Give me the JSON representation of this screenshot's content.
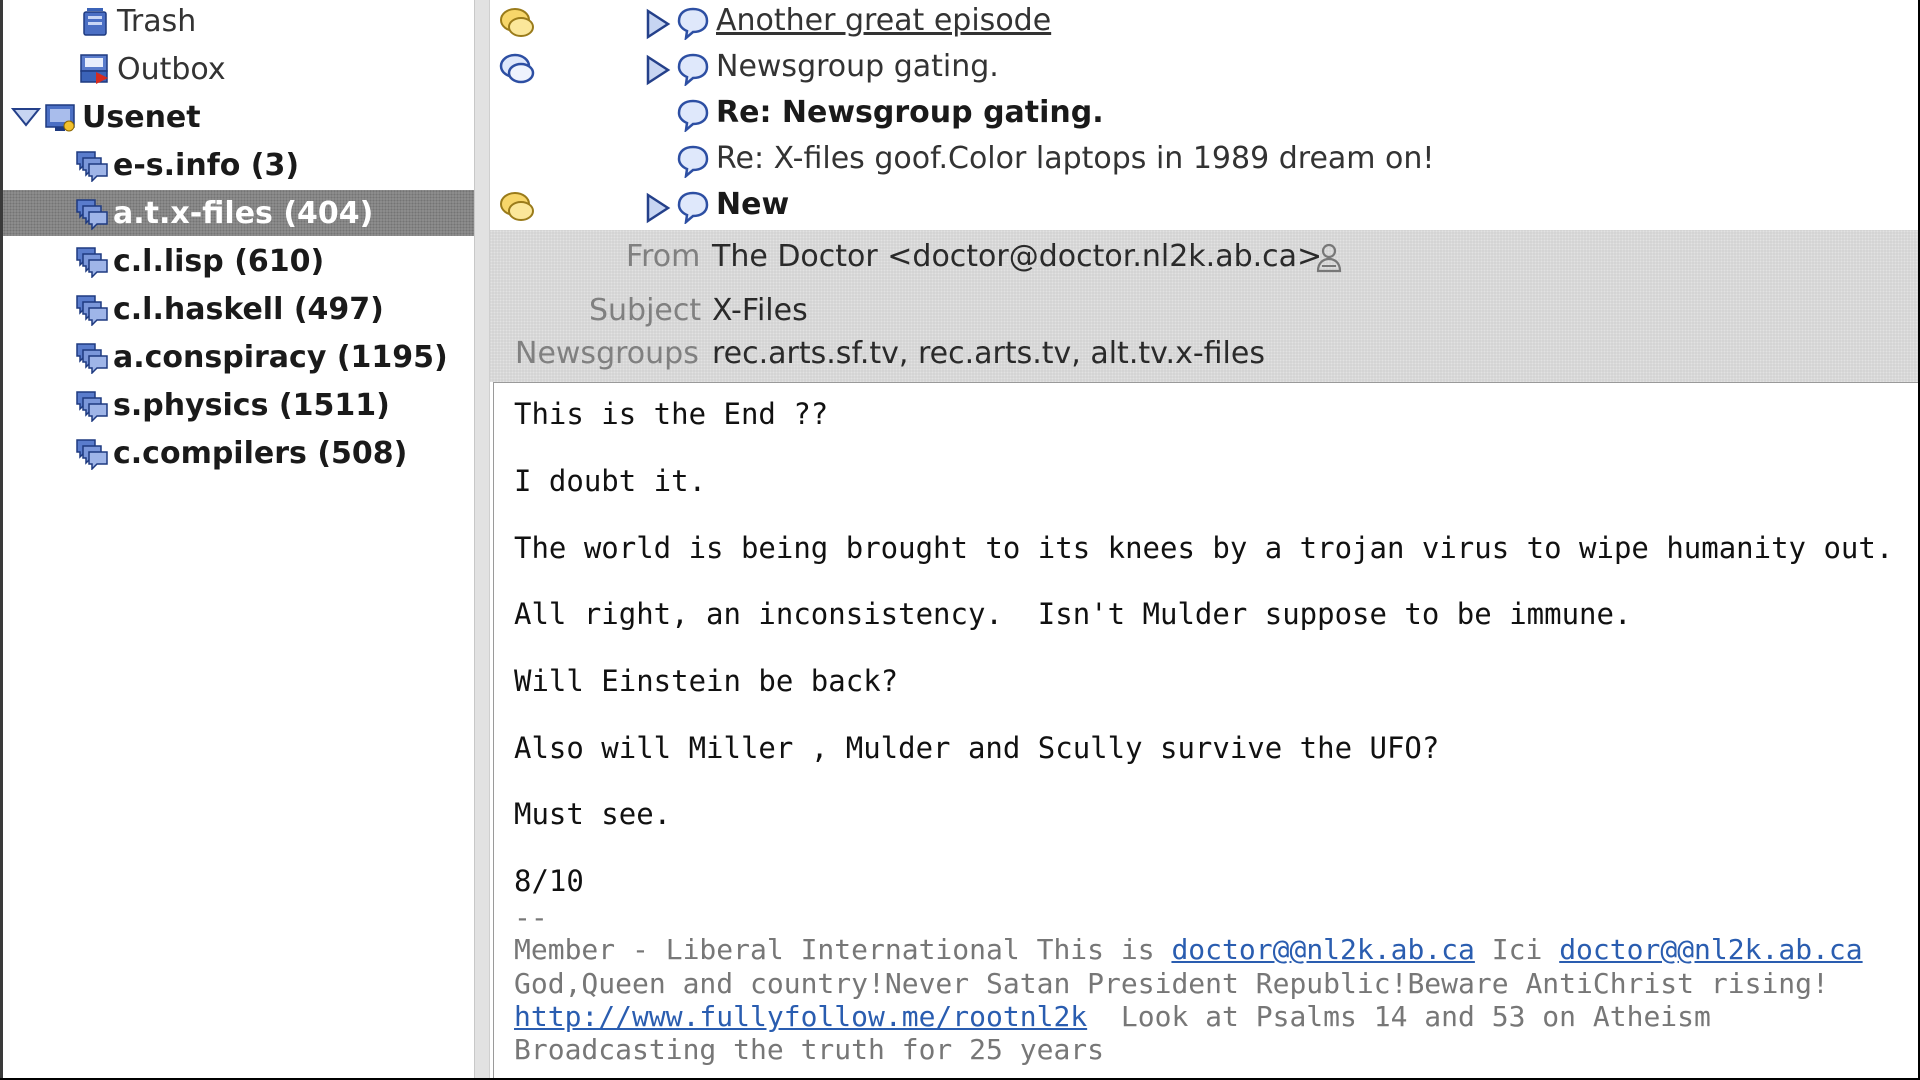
{
  "folders": [
    {
      "label": "Trash",
      "icon": "trash-icon"
    },
    {
      "label": "Outbox",
      "icon": "outbox-icon"
    },
    {
      "label": "Usenet",
      "icon": "server-icon"
    },
    {
      "label": "e-s.info (3)",
      "icon": "newsgroup-icon"
    },
    {
      "label": "a.t.x-files (404)",
      "icon": "newsgroup-icon",
      "selected": true
    },
    {
      "label": "c.l.lisp (610)",
      "icon": "newsgroup-icon"
    },
    {
      "label": "c.l.haskell (497)",
      "icon": "newsgroup-icon"
    },
    {
      "label": "a.conspiracy (1195)",
      "icon": "newsgroup-icon"
    },
    {
      "label": "s.physics (1511)",
      "icon": "newsgroup-icon"
    },
    {
      "label": "c.compilers (508)",
      "icon": "newsgroup-icon"
    }
  ],
  "messages": [
    {
      "subject": "Another great episode"
    },
    {
      "subject": "Newsgroup gating."
    },
    {
      "subject": "Re: Newsgroup gating."
    },
    {
      "subject": "Re: X-files goof.Color laptops in 1989 dream on!"
    },
    {
      "subject": "New"
    }
  ],
  "header": {
    "from_label": "From",
    "from_value": "The Doctor <doctor@doctor.nl2k.ab.ca>",
    "subject_label": "Subject",
    "subject_value": "X-Files",
    "newsgroups_label": "Newsgroups",
    "newsgroups_value": "rec.arts.sf.tv, rec.arts.tv, alt.tv.x-files"
  },
  "body": {
    "lines": [
      "This is the End ??",
      "I doubt it.",
      "The world is being brought to its knees by a trojan virus to wipe humanity out.",
      "All right, an inconsistency.  Isn't Mulder suppose to be immune.",
      "Will Einstein be back?",
      "Also will Miller , Mulder and Scully survive the UFO?",
      "Must see.",
      "8/10"
    ],
    "sig_separator": "--",
    "sig1_text": "Member - Liberal International This is ",
    "sig1_link1": "doctor@@nl2k.ab.ca",
    "sig1_mid": " Ici ",
    "sig1_link2": "doctor@@nl2k.ab.ca",
    "sig2": "God,Queen and country!Never Satan President Republic!Beware AntiChrist rising!",
    "sig3_link": "http://www.fullyfollow.me/rootnl2k",
    "sig3_text": "  Look at Psalms 14 and 53 on Atheism",
    "sig4": "Broadcasting the truth for 25 years"
  },
  "colors": {
    "selection": "#8e8e8e",
    "header_background": "#d3d3d3",
    "link": "#2a5db0",
    "icon_blue": "#3b63b8"
  }
}
